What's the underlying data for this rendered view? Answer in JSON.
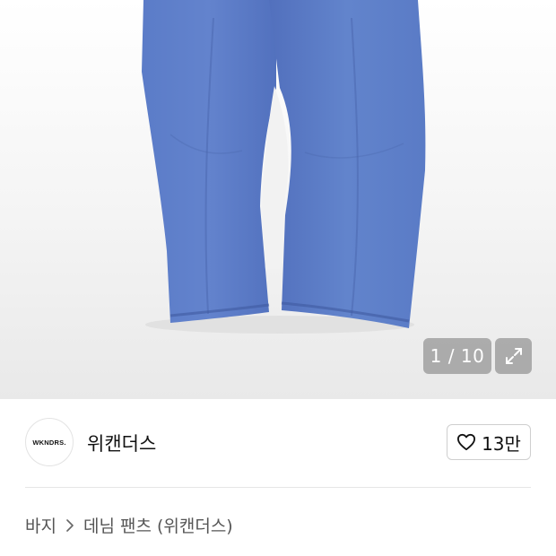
{
  "gallery": {
    "counter": "1 / 10",
    "expand_icon": "expand-icon"
  },
  "seller": {
    "logo_text": "WKNDRS.",
    "name": "위캔더스",
    "like_icon": "heart-outline-icon",
    "like_count": "13만"
  },
  "breadcrumb": {
    "category": "바지",
    "separator_icon": "chevron-right-icon",
    "product": "데님 팬츠 (위캔더스)"
  },
  "colors": {
    "denim": "#5777c2",
    "overlay": "#a0a0a0"
  }
}
